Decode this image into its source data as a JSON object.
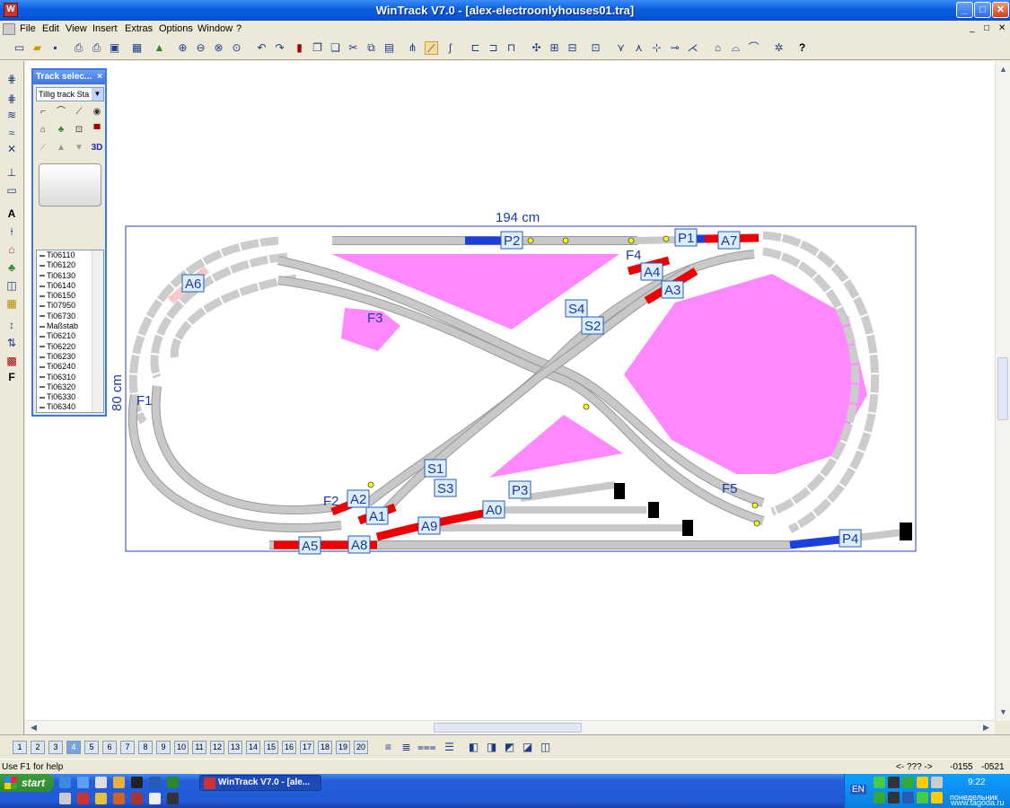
{
  "window": {
    "title": "WinTrack  V7.0 - [alex-electroonlyhouses01.tra]",
    "controls": [
      "_",
      "□",
      "✕"
    ],
    "doc_controls": [
      "_",
      "□",
      "✕"
    ]
  },
  "menu": [
    "File",
    "Edit",
    "View",
    "Insert",
    "Extras",
    "Options",
    "Window",
    "?"
  ],
  "track_panel": {
    "title": "Track selec...",
    "close": "×",
    "selected_system": "Tillig track Sta",
    "three_d": "3D",
    "items": [
      "Ti06110",
      "Ti06120",
      "Ti06130",
      "Ti06140",
      "Ti06150",
      "Ti07950",
      "Ti06730",
      "Maßstab",
      "Ti06210",
      "Ti06220",
      "Ti06230",
      "Ti06240",
      "Ti06310",
      "Ti06320",
      "Ti06330",
      "Ti06340"
    ]
  },
  "layout": {
    "width_label": "194 cm",
    "height_label": "80 cm",
    "labels": [
      "F1",
      "F2",
      "F3",
      "F4",
      "F5"
    ],
    "tags": [
      "P1",
      "P2",
      "P3",
      "P4",
      "A0",
      "A1",
      "A2",
      "A3",
      "A4",
      "A5",
      "A6",
      "A7",
      "A8",
      "A9",
      "S1",
      "S2",
      "S3",
      "S4"
    ]
  },
  "layers": [
    "1",
    "2",
    "3",
    "4",
    "5",
    "6",
    "7",
    "8",
    "9",
    "10",
    "11",
    "12",
    "13",
    "14",
    "15",
    "16",
    "17",
    "18",
    "19",
    "20"
  ],
  "status": {
    "help": "Use F1 for help",
    "mode": "<- ??? ->",
    "x": "-0155",
    "y": "-0521"
  },
  "taskbar": {
    "start": "start",
    "task": "WinTrack  V7.0 - [ale...",
    "lang": "EN",
    "time": "9:22",
    "day": "понедельник",
    "watermark": "www.tagoda.ru"
  }
}
